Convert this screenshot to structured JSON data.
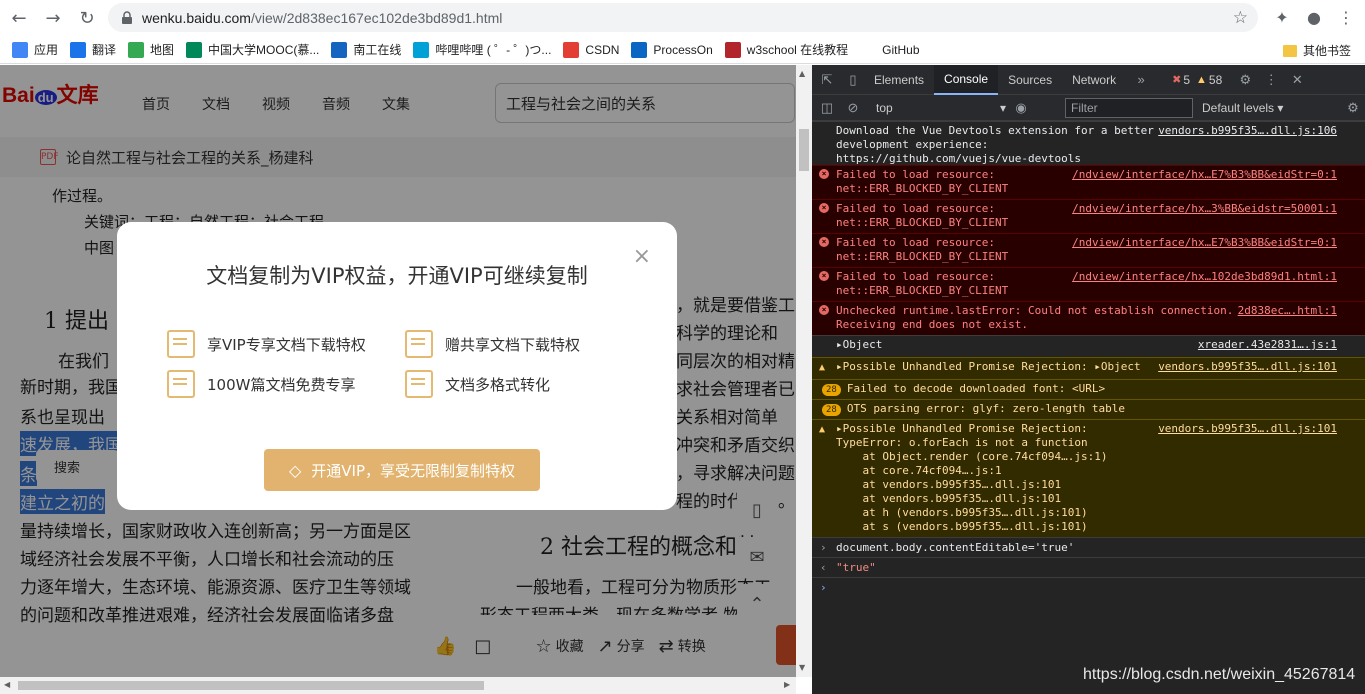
{
  "browser": {
    "url_domain": "wenku.baidu.com",
    "url_path": "/view/2d838ec167ec102de3bd89d1.html",
    "bookmarks": [
      {
        "label": "应用",
        "color": "#4285f4"
      },
      {
        "label": "翻译",
        "color": "#1a73e8"
      },
      {
        "label": "地图",
        "color": "#34a853"
      },
      {
        "label": "中国大学MOOC(慕...",
        "color": "#00875a"
      },
      {
        "label": "南工在线",
        "color": "#1565c0"
      },
      {
        "label": "哔哩哔哩 ( ゜- ゜)つ...",
        "color": "#00a1d6"
      },
      {
        "label": "CSDN",
        "color": "#e33e33"
      },
      {
        "label": "ProcessOn",
        "color": "#0a66c2"
      },
      {
        "label": "w3school 在线教程",
        "color": "#b1252b"
      },
      {
        "label": "GitHub",
        "color": "#ffffff"
      }
    ],
    "other_bookmarks": "其他书签"
  },
  "baidu": {
    "logo_bai": "Bai",
    "logo_du": "du",
    "logo_wenku": "文库",
    "nav": [
      "首页",
      "文档",
      "视频",
      "音频",
      "文集"
    ],
    "search_value": "工程与社会之间的关系",
    "doc_title": "论自然工程与社会工程的关系_杨建科",
    "pdf_badge": "PDF"
  },
  "document": {
    "lines": [
      "作过程。",
      "关键词：工程；自然工程；社会工程",
      "中图",
      "1  提出",
      "在我们",
      "新时期，我国",
      "系也呈现出",
      "速发展，我国",
      "条",
      "建立之初的",
      "量持续增长，国家财政收入连创新高；另一方面是区",
      "域经济社会发展不平衡，人口增长和社会流动的压",
      "力逐年增大，生态环境、能源资源、医疗卫生等领域",
      "的问题和改革推进艰难，经济社会发展面临诸多盘",
      "，就是要借鉴工",
      "科学的理论和",
      "同层次的相对精",
      "求社会管理者已",
      "关系相对简单",
      "冲突和矛盾交织",
      "，寻求解决问题",
      "程的时代意义。",
      "2  社会工程的概念和特",
      "一般地看，工程可分为物质形态工",
      "形态工程两大类，现在多数学者  物"
    ]
  },
  "modal": {
    "title": "文档复制为VIP权益，开通VIP可继续复制",
    "close": "×",
    "perks": [
      "享VIP专享文档下载特权",
      "赠共享文档下载特权",
      "100W篇文档免费专享",
      "文档多格式转化"
    ],
    "cta": "开通VIP，享受无限制复制特权"
  },
  "page_ui": {
    "search_float": "搜索",
    "bottom": {
      "collect": "收藏",
      "share": "分享",
      "convert": "转换"
    }
  },
  "devtools": {
    "tabs": [
      "Elements",
      "Console",
      "Sources",
      "Network"
    ],
    "active_tab": "Console",
    "error_count": "5",
    "warning_count": "58",
    "context": "top",
    "filter_placeholder": "Filter",
    "levels": "Default levels",
    "messages": [
      {
        "type": "plain",
        "text": "Download the Vue Devtools extension for a better\ndevelopment experience:\nhttps://github.com/vuejs/vue-devtools",
        "source": "vendors.b995f35….dll.js:106"
      },
      {
        "type": "err",
        "text": "Failed to load resource:\nnet::ERR_BLOCKED_BY_CLIENT",
        "source": "/ndview/interface/hx…E7%B3%BB&eidStr=0:1"
      },
      {
        "type": "err",
        "text": "Failed to load resource:\nnet::ERR_BLOCKED_BY_CLIENT",
        "source": "/ndview/interface/hx…3%BB&eidstr=50001:1"
      },
      {
        "type": "err",
        "text": "Failed to load resource:\nnet::ERR_BLOCKED_BY_CLIENT",
        "source": "/ndview/interface/hx…E7%B3%BB&eidStr=0:1"
      },
      {
        "type": "err",
        "text": "Failed to load resource:\nnet::ERR_BLOCKED_BY_CLIENT",
        "source": "/ndview/interface/hx…102de3bd89d1.html:1"
      },
      {
        "type": "err",
        "text": "Unchecked runtime.lastError: Could not establish connection.\nReceiving end does not exist.",
        "source": "2d838ec….html:1"
      },
      {
        "type": "plain",
        "text": "▸Object",
        "source": "xreader.43e2831….js:1"
      },
      {
        "type": "warn",
        "text": "▸Possible Unhandled Promise Rejection: ▸Object",
        "source": "vendors.b995f35….dll.js:101"
      },
      {
        "type": "warn",
        "badge": "28",
        "text": "Failed to decode downloaded font: <URL>",
        "source": ""
      },
      {
        "type": "warn",
        "badge": "28",
        "text": "OTS parsing error: glyf: zero-length table",
        "source": ""
      },
      {
        "type": "warn",
        "text": "▸Possible Unhandled Promise Rejection:\nTypeError: o.forEach is not a function\n    at Object.render (core.74cf094….js:1)\n    at core.74cf094….js:1\n    at vendors.b995f35….dll.js:101\n    at vendors.b995f35….dll.js:101\n    at h (vendors.b995f35….dll.js:101)\n    at s (vendors.b995f35….dll.js:101)",
        "source": "vendors.b995f35….dll.js:101"
      }
    ],
    "command_input": "document.body.contentEditable='true'",
    "command_result": "\"true\""
  },
  "watermark": "https://blog.csdn.net/weixin_45267814"
}
